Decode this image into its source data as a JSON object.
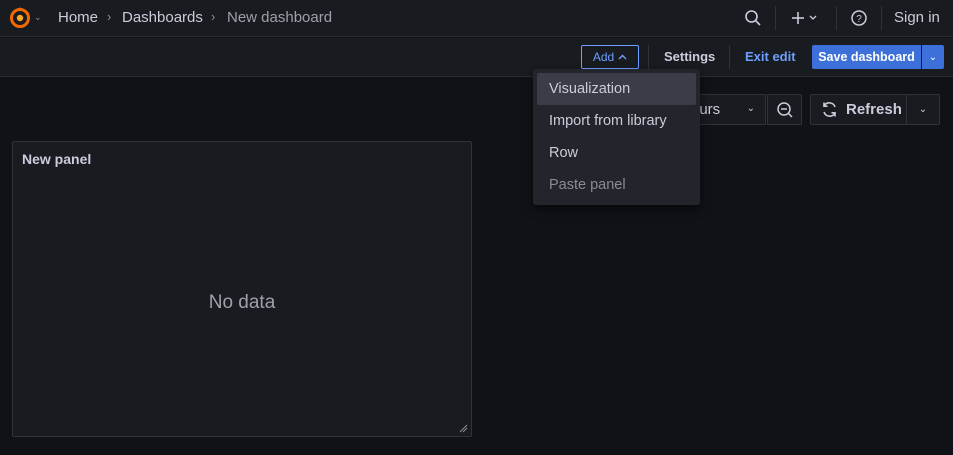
{
  "colors": {
    "background": "#111217",
    "bar": "#181b1f",
    "primary": "#3d71d9",
    "link": "#6e9fff",
    "logo": "#f46800"
  },
  "topbar": {
    "logo_icon": "grafana-logo",
    "breadcrumbs": [
      "Home",
      "Dashboards",
      "New dashboard"
    ],
    "icons": [
      "search-icon",
      "plus-icon",
      "help-icon"
    ],
    "sign_in": "Sign in"
  },
  "toolbar": {
    "add_label": "Add",
    "settings_label": "Settings",
    "exit_edit_label": "Exit edit",
    "save_label": "Save dashboard"
  },
  "controls": {
    "time_range_partial": "ours",
    "refresh_label": "Refresh"
  },
  "add_menu": {
    "items": [
      {
        "label": "Visualization",
        "state": "highlighted"
      },
      {
        "label": "Import from library",
        "state": "normal"
      },
      {
        "label": "Row",
        "state": "normal"
      },
      {
        "label": "Paste panel",
        "state": "disabled"
      }
    ]
  },
  "panel": {
    "title": "New panel",
    "empty_text": "No data"
  }
}
